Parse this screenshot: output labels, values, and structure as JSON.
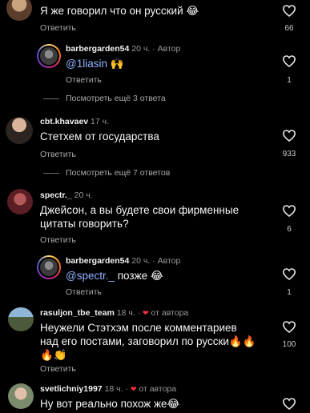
{
  "comments": [
    {
      "text": "Я же говорил что он русский 😂",
      "reply_label": "Ответить",
      "likes": "66"
    },
    {
      "username": "barbergarden54",
      "time": "20 ч. · Автор",
      "mention": "@1liasin",
      "text_after": " 🙌",
      "reply_label": "Ответить",
      "likes": "1"
    },
    {
      "more_label": "Посмотреть ещё 3 ответа"
    },
    {
      "username": "cbt.khavaev",
      "time": "17 ч.",
      "text": "Стетхем от государства",
      "reply_label": "Ответить",
      "likes": "933"
    },
    {
      "more_label": "Посмотреть ещё 7 ответов"
    },
    {
      "username": "spectr._",
      "time": "20 ч.",
      "text": "Джейсон, а вы будете свои фирменные цитаты говорить?",
      "reply_label": "Ответить",
      "likes": "6"
    },
    {
      "username": "barbergarden54",
      "time": "20 ч. · Автор",
      "mention": "@spectr._",
      "text_after": " позже 😂",
      "reply_label": "Ответить",
      "likes": "1"
    },
    {
      "username": "rasuljon_tbe_team",
      "time": "18 ч. ·",
      "author_note": "от автора",
      "text": "Неужели Стэтхэм после комментариев над его постами, заговорил по русски🔥🔥🔥👏",
      "reply_label": "Ответить",
      "likes": "100"
    },
    {
      "username": "svetlichniy1997",
      "time": "18 ч. ·",
      "author_note": "от автора",
      "text": "Ну вот реально похож же😂"
    }
  ],
  "colors": {
    "background": "#000000",
    "mention": "#8fb3ff",
    "liked_heart": "#ff3040"
  },
  "icons": [
    "heart-outline-icon",
    "heart-filled-icon"
  ]
}
